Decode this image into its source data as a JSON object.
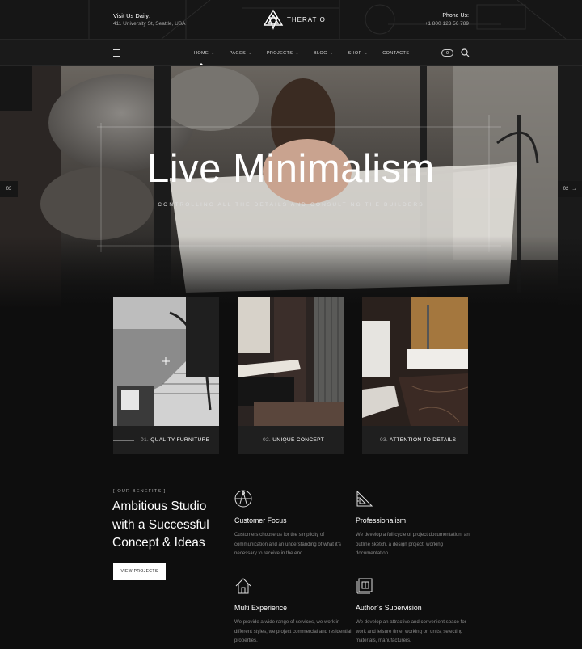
{
  "topbar": {
    "visit_label": "Visit Us Daily:",
    "address": "411 University St, Seattle, USA",
    "brand": "THERATIO",
    "phone_label": "Phone Us:",
    "phone": "+1 800 123 56 789"
  },
  "nav": {
    "items": [
      {
        "label": "HOME",
        "has_dropdown": true,
        "active": true
      },
      {
        "label": "PAGES",
        "has_dropdown": true
      },
      {
        "label": "PROJECTS",
        "has_dropdown": true
      },
      {
        "label": "BLOG",
        "has_dropdown": true
      },
      {
        "label": "SHOP",
        "has_dropdown": true
      },
      {
        "label": "CONTACTS",
        "has_dropdown": false
      }
    ],
    "cart_count": "0"
  },
  "hero": {
    "title": "Live Minimalism",
    "subtitle": "CONTROLLING ALL THE DETAILS AND CONSULTING THE BUILDERS",
    "prev_label": "03",
    "next_label": "02"
  },
  "cards": [
    {
      "num": "01.",
      "label": "QUALITY FURNITURE"
    },
    {
      "num": "02.",
      "label": "UNIQUE CONCEPT"
    },
    {
      "num": "03.",
      "label": "ATTENTION TO DETAILS"
    }
  ],
  "benefits": {
    "tag": "[ OUR BENEFITS ]",
    "title": "Ambitious Studio with a Successful Concept & Ideas",
    "button": "VIEW PROJECTS",
    "features": [
      {
        "icon": "compass-icon",
        "title": "Customer Focus",
        "text": "Customers choose us for the simplicity of communication and an understanding of what it's necessary to receive in the end."
      },
      {
        "icon": "ruler-triangle-icon",
        "title": "Professionalism",
        "text": "We develop a full cycle of project documentation: an outline sketch, a design project, working documentation."
      },
      {
        "icon": "house-icon",
        "title": "Multi Experience",
        "text": "We provide a wide range of services, we work in different styles,  we project commercial and residential properties."
      },
      {
        "icon": "blueprint-icon",
        "title": "Author`s Supervision",
        "text": "We develop an attractive and convenient space for work and leisure time, working on units, selecting materials, manufacturers."
      }
    ]
  },
  "colors": {
    "background": "#0e0e0e",
    "topbar": "#161616",
    "navbar": "#1a1a1a",
    "text": "#ffffff",
    "muted": "#8a8a8a"
  }
}
